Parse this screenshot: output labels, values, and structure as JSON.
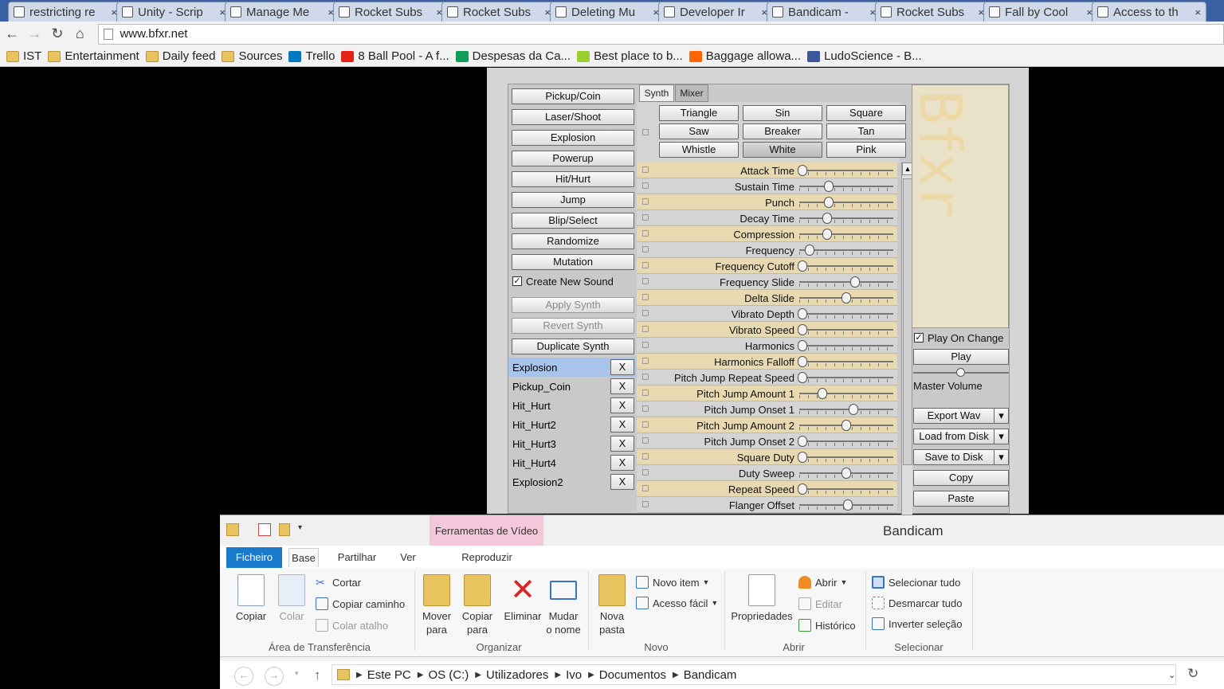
{
  "browser": {
    "tabs": [
      {
        "label": "restricting re",
        "icon": "unity-icon"
      },
      {
        "label": "Unity - Scrip",
        "icon": "unity-icon"
      },
      {
        "label": "Manage Me",
        "icon": "doc-icon"
      },
      {
        "label": "Rocket Subs",
        "icon": "doc-icon"
      },
      {
        "label": "Rocket Subs",
        "icon": "doc-icon"
      },
      {
        "label": "Deleting Mu",
        "icon": "doc-icon"
      },
      {
        "label": "Developer Ir",
        "icon": "gmail-icon"
      },
      {
        "label": "Bandicam - ",
        "icon": "bandicam-icon"
      },
      {
        "label": "Rocket Subs",
        "icon": "doc-icon"
      },
      {
        "label": "Fall by Cool",
        "icon": "doc-icon"
      },
      {
        "label": "Access to th",
        "icon": "google-icon"
      }
    ],
    "close_glyph": "×",
    "url": "www.bfxr.net",
    "bookmarks": [
      {
        "label": "IST",
        "icon": "folder"
      },
      {
        "label": "Entertainment",
        "icon": "folder"
      },
      {
        "label": "Daily feed",
        "icon": "folder"
      },
      {
        "label": "Sources",
        "icon": "folder"
      },
      {
        "label": "Trello",
        "icon": "trello"
      },
      {
        "label": "8 Ball Pool - A f...",
        "icon": "youtube"
      },
      {
        "label": "Despesas da Ca...",
        "icon": "sheets"
      },
      {
        "label": "Best place to b...",
        "icon": "smiley"
      },
      {
        "label": "Baggage allowa...",
        "icon": "easyjet"
      },
      {
        "label": "LudoScience - B...",
        "icon": "facebook"
      }
    ]
  },
  "bfxr": {
    "presets": [
      "Pickup/Coin",
      "Laser/Shoot",
      "Explosion",
      "Powerup",
      "Hit/Hurt",
      "Jump",
      "Blip/Select",
      "Randomize",
      "Mutation"
    ],
    "create_new_sound": "Create New Sound",
    "apply_synth": "Apply Synth",
    "revert_synth": "Revert Synth",
    "duplicate_synth": "Duplicate Synth",
    "sounds": [
      "Explosion",
      "Pickup_Coin",
      "Hit_Hurt",
      "Hit_Hurt2",
      "Hit_Hurt3",
      "Hit_Hurt4",
      "Explosion2"
    ],
    "delete_label": "X",
    "tabs": [
      "Synth",
      "Mixer"
    ],
    "waveforms": [
      "Triangle",
      "Sin",
      "Square",
      "Saw",
      "Breaker",
      "Tan",
      "Whistle",
      "White",
      "Pink"
    ],
    "selected_waveform": "White",
    "params": [
      {
        "label": "Attack Time",
        "value": 0.0
      },
      {
        "label": "Sustain Time",
        "value": 0.3
      },
      {
        "label": "Punch",
        "value": 0.3
      },
      {
        "label": "Decay Time",
        "value": 0.28
      },
      {
        "label": "Compression",
        "value": 0.28
      },
      {
        "label": "Frequency",
        "value": 0.08
      },
      {
        "label": "Frequency Cutoff",
        "value": 0.0
      },
      {
        "label": "Frequency Slide",
        "value": 0.6
      },
      {
        "label": "Delta Slide",
        "value": 0.5
      },
      {
        "label": "Vibrato Depth",
        "value": 0.0
      },
      {
        "label": "Vibrato Speed",
        "value": 0.0
      },
      {
        "label": "Harmonics",
        "value": 0.0
      },
      {
        "label": "Harmonics Falloff",
        "value": 0.0
      },
      {
        "label": "Pitch Jump Repeat Speed",
        "value": 0.0
      },
      {
        "label": "Pitch Jump Amount 1",
        "value": 0.23
      },
      {
        "label": "Pitch Jump Onset 1",
        "value": 0.58
      },
      {
        "label": "Pitch Jump Amount 2",
        "value": 0.5
      },
      {
        "label": "Pitch Jump Onset 2",
        "value": 0.0
      },
      {
        "label": "Square Duty",
        "value": 0.0
      },
      {
        "label": "Duty Sweep",
        "value": 0.5
      },
      {
        "label": "Repeat Speed",
        "value": 0.0
      },
      {
        "label": "Flanger Offset",
        "value": 0.52
      }
    ],
    "logo_text": "Bfxr",
    "play_on_change": "Play On Change",
    "play": "Play",
    "master_volume_label": "Master Volume",
    "master_volume": 0.5,
    "export_wav": "Export Wav",
    "load_from_disk": "Load from Disk",
    "save_to_disk": "Save to Disk",
    "copy": "Copy",
    "paste": "Paste"
  },
  "explorer": {
    "title": "Bandicam",
    "video_tools": "Ferramentas de Vídeo",
    "ribbon_tabs": [
      "Ficheiro",
      "Base",
      "Partilhar",
      "Ver",
      "Reproduzir"
    ],
    "clipboard": {
      "copiar": "Copiar",
      "colar": "Colar",
      "cortar": "Cortar",
      "copiar_caminho": "Copiar caminho",
      "colar_atalho": "Colar atalho",
      "group": "Área de Transferência"
    },
    "organize": {
      "mover_1": "Mover",
      "mover_2": "para",
      "copiar_1": "Copiar",
      "copiar_2": "para",
      "eliminar": "Eliminar",
      "mudar_1": "Mudar",
      "mudar_2": "o nome",
      "group": "Organizar"
    },
    "new": {
      "nova_1": "Nova",
      "nova_2": "pasta",
      "novo_item": "Novo item",
      "acesso_facil": "Acesso fácil",
      "group": "Novo"
    },
    "open": {
      "propriedades": "Propriedades",
      "abrir": "Abrir",
      "editar": "Editar",
      "historico": "Histórico",
      "group": "Abrir"
    },
    "select": {
      "selecionar_tudo": "Selecionar tudo",
      "desmarcar_tudo": "Desmarcar tudo",
      "inverter": "Inverter seleção",
      "group": "Selecionar"
    },
    "path": [
      "Este PC",
      "OS (C:)",
      "Utilizadores",
      "Ivo",
      "Documentos",
      "Bandicam"
    ]
  }
}
